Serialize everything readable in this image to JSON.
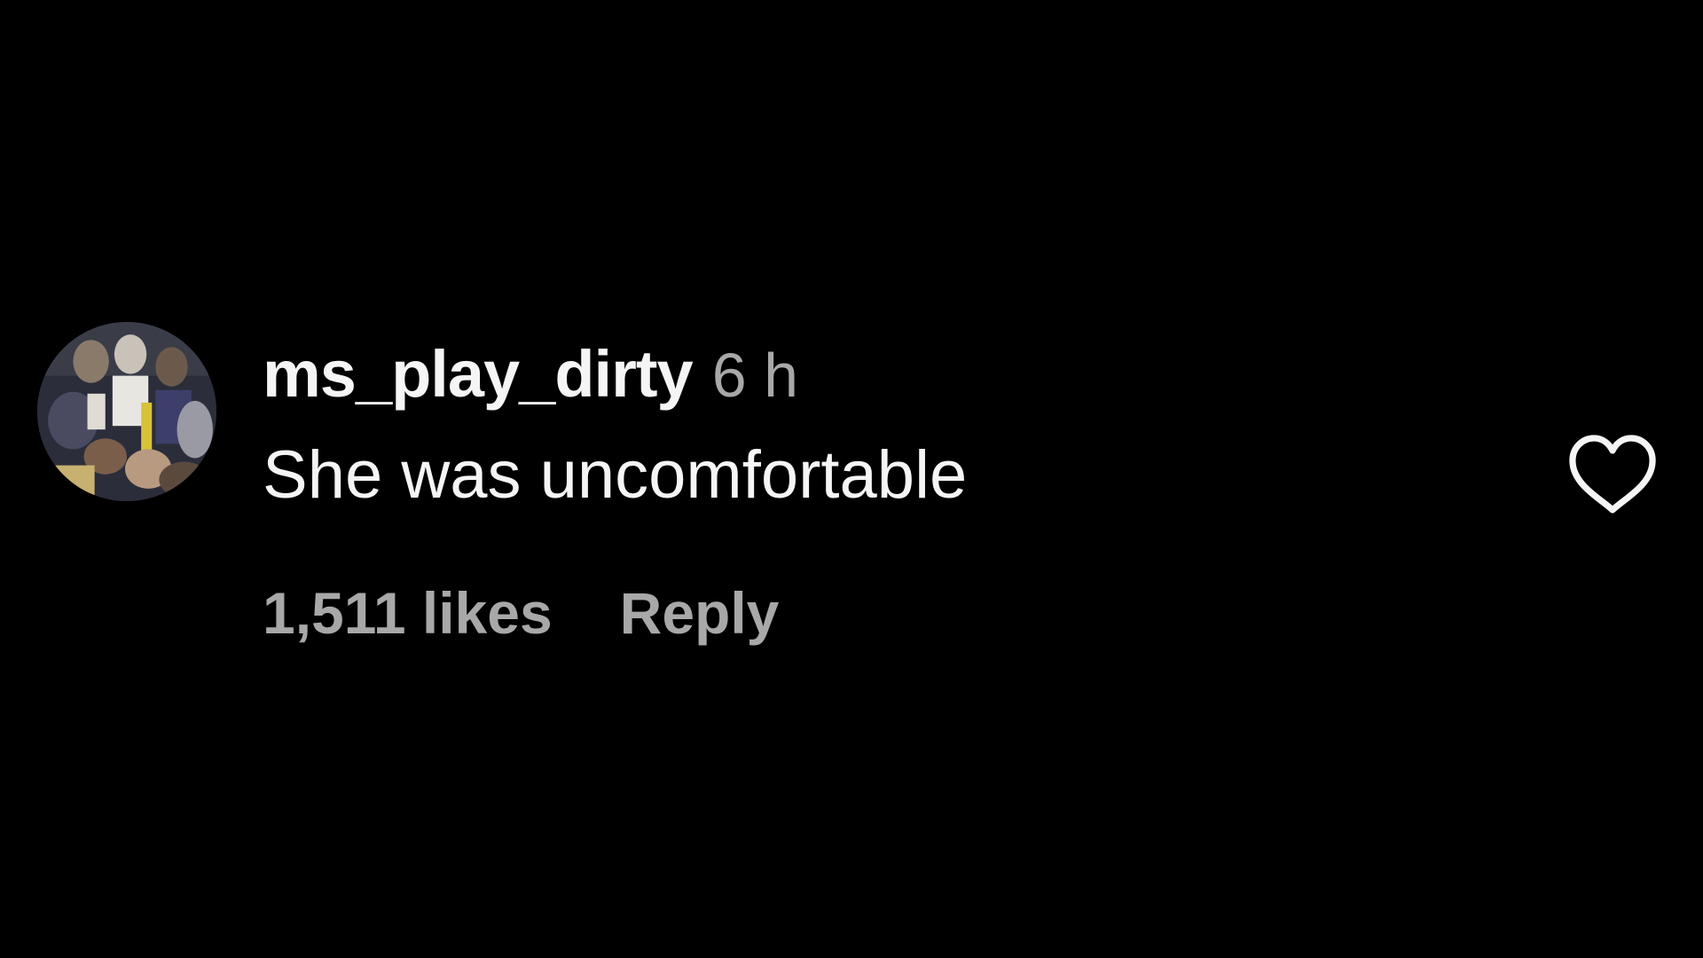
{
  "comment": {
    "username": "ms_play_dirty",
    "timestamp": "6 h",
    "text": "She was uncomfortable",
    "likes": "1,511 likes",
    "reply_label": "Reply",
    "like_icon": "heart-outline-icon",
    "avatar": "user-avatar"
  },
  "colors": {
    "background": "#000000",
    "primary_text": "#f5f5f5",
    "secondary_text": "#a8a8a8"
  }
}
